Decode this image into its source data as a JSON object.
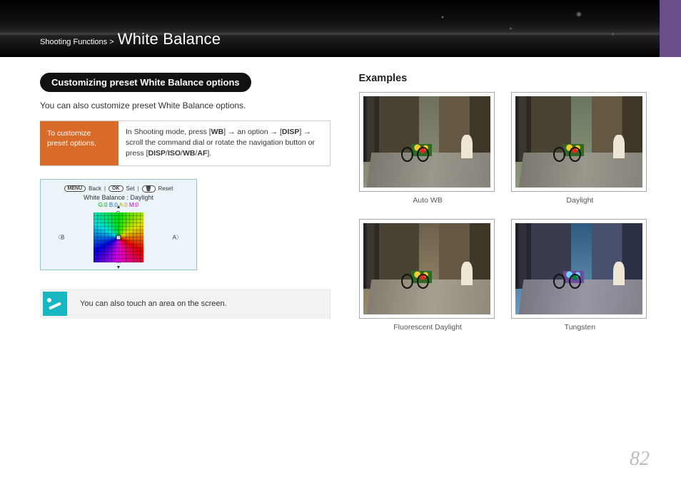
{
  "header": {
    "breadcrumb_section": "Shooting Functions",
    "breadcrumb_sep": ">",
    "title": "White Balance"
  },
  "left": {
    "pill": "Customizing preset White Balance options",
    "intro": "You can also customize preset White Balance options.",
    "howto_label": "To customize preset options,",
    "howto_pre": "In Shooting mode, press [",
    "k_wb": "WB",
    "howto_mid1": "] → an option → [",
    "k_disp": "DISP",
    "howto_mid2": "] → scroll the command dial or rotate the navigation button or press [",
    "k_iso": "ISO",
    "k_af": "AF",
    "howto_end": "].",
    "slash": "/",
    "shot": {
      "btn_menu": "MENU",
      "lab_back": "Back",
      "btn_ok": "OK",
      "lab_set": "Set",
      "btn_del": "🗑",
      "lab_reset": "Reset",
      "title": "White Balance : Daylight",
      "colors": {
        "g": "G:0",
        "b": "B:0",
        "a": "A:0",
        "m": "M:0"
      },
      "axis": {
        "g": "G",
        "m": "M",
        "b": "B",
        "a": "A"
      }
    },
    "note": "You can also touch an area on the screen."
  },
  "right": {
    "title": "Examples",
    "captions": {
      "auto": "Auto WB",
      "day": "Daylight",
      "flu": "Fluorescent Daylight",
      "tung": "Tungsten"
    }
  },
  "page_number": "82"
}
